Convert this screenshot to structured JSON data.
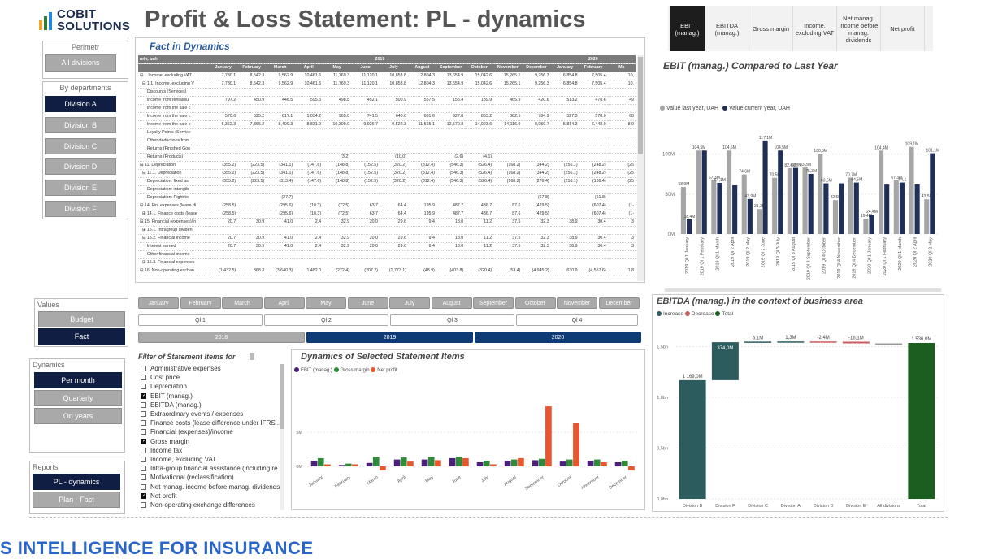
{
  "brand": {
    "logo_line1": "COBIT",
    "logo_line2": "SOLUTIONS",
    "logo_colors": [
      "#f5a623",
      "#2e7d32",
      "#1e88e5"
    ]
  },
  "title": "Profit & Loss Statement: PL - dynamics",
  "bottom_banner": "S INTELLIGENCE FOR INSURANCE",
  "perimetr": {
    "title": "Perimetr",
    "all_label": "All divisions",
    "by_departments": "By departments",
    "divisions": [
      "Division A",
      "Division B",
      "Division C",
      "Division D",
      "Division E",
      "Division F"
    ],
    "active": "Division A"
  },
  "values": {
    "title": "Values",
    "items": [
      "Budget",
      "Fact"
    ],
    "active": "Fact"
  },
  "dynamics": {
    "title": "Dynamics",
    "items": [
      "Per month",
      "Quarterly",
      "On years"
    ],
    "active": "Per month"
  },
  "reports": {
    "title": "Reports",
    "items": [
      "PL - dynamics",
      "Plan - Fact"
    ],
    "active": "PL - dynamics"
  },
  "fact_table": {
    "title": "Fact in Dynamics",
    "unit": "mln, uah",
    "years": [
      "2019",
      "2020"
    ],
    "months": [
      "January",
      "February",
      "March",
      "April",
      "May",
      "June",
      "July",
      "August",
      "September",
      "October",
      "November",
      "December",
      "January",
      "February",
      "Ma"
    ],
    "rows": [
      {
        "label": "⊟ I. Income, excluding VAT",
        "vals": [
          "7,780.1",
          "8,542.3",
          "9,562.9",
          "10,461.6",
          "11,769.3",
          "11,120.1",
          "10,853.8",
          "12,804.3",
          "13,654.9",
          "15,042.6",
          "15,265.1",
          "9,256.3",
          "6,854.8",
          "7,505.4",
          "10,"
        ]
      },
      {
        "label": "  ⊟ 1.1. Income, excluding V",
        "vals": [
          "7,780.1",
          "8,542.3",
          "9,562.9",
          "10,461.6",
          "11,769.3",
          "11,120.1",
          "10,853.8",
          "12,804.3",
          "13,654.9",
          "15,042.6",
          "15,265.1",
          "9,256.3",
          "6,854.8",
          "7,505.4",
          "10,"
        ]
      },
      {
        "label": "      Discounts (Services)",
        "vals": [
          "",
          "",
          "",
          "",
          "",
          "",
          "",
          "",
          "",
          "",
          "",
          "",
          "",
          "",
          ""
        ]
      },
      {
        "label": "      Income from rental/su",
        "vals": [
          "797.2",
          "450.9",
          "446.5",
          "595.5",
          "498.5",
          "452.1",
          "500.9",
          "557.5",
          "155.4",
          "189.9",
          "465.9",
          "420.6",
          "513.2",
          "478.6",
          "49"
        ]
      },
      {
        "label": "      Income from the sale c",
        "vals": [
          "",
          "",
          "",
          "",
          "",
          "",
          "",
          "",
          "",
          "",
          "",
          "",
          "",
          "",
          ""
        ]
      },
      {
        "label": "      Income from the sale c",
        "vals": [
          "570.6",
          "525.2",
          "617.1",
          "1,034.2",
          "965.0",
          "741.5",
          "640.6",
          "681.6",
          "927.8",
          "853.2",
          "682.5",
          "784.9",
          "527.3",
          "578.0",
          "68"
        ]
      },
      {
        "label": "      Income from the sale c",
        "vals": [
          "6,362.3",
          "7,366.2",
          "8,499.3",
          "8,831.9",
          "10,309.0",
          "9,926.7",
          "9,522.3",
          "11,565.1",
          "12,570.8",
          "14,023.6",
          "14,116.9",
          "8,050.7",
          "5,814.3",
          "6,448.9",
          "8,9"
        ]
      },
      {
        "label": "      Loyalty Points (Service",
        "vals": [
          "",
          "",
          "",
          "",
          "",
          "",
          "",
          "",
          "",
          "",
          "",
          "",
          "",
          "",
          ""
        ]
      },
      {
        "label": "      Other deductions from",
        "vals": [
          "",
          "",
          "",
          "",
          "",
          "",
          "",
          "",
          "",
          "",
          "",
          "",
          "",
          "",
          ""
        ]
      },
      {
        "label": "      Returns (Finished Goo",
        "vals": [
          "",
          "",
          "",
          "",
          "",
          "",
          "",
          "",
          "",
          "",
          "",
          "",
          "",
          "",
          ""
        ]
      },
      {
        "label": "      Returns (Products)",
        "vals": [
          "",
          "",
          "",
          "",
          "(3.2)",
          "",
          "(10.0)",
          "",
          "(2.6)",
          "(4.1)",
          "",
          "",
          "",
          "",
          ""
        ]
      },
      {
        "label": "⊟ 11. Depreciation",
        "vals": [
          "(355.2)",
          "(223.5)",
          "(341.1)",
          "(147.6)",
          "(148.8)",
          "(152.5)",
          "(320.2)",
          "(312.4)",
          "(546.3)",
          "(526.4)",
          "(168.2)",
          "(344.2)",
          "(256.1)",
          "(248.2)",
          "(25"
        ]
      },
      {
        "label": "  ⊟ 11.1. Depreciation",
        "vals": [
          "(355.2)",
          "(223.5)",
          "(341.1)",
          "(147.6)",
          "(148.8)",
          "(152.5)",
          "(320.2)",
          "(312.4)",
          "(546.3)",
          "(526.4)",
          "(168.2)",
          "(344.2)",
          "(256.1)",
          "(248.2)",
          "(25"
        ]
      },
      {
        "label": "      Depreciation: fixed as",
        "vals": [
          "(355.2)",
          "(223.5)",
          "(313.4)",
          "(147.6)",
          "(148.8)",
          "(152.5)",
          "(320.2)",
          "(312.4)",
          "(546.3)",
          "(526.4)",
          "(168.2)",
          "(276.4)",
          "(256.1)",
          "(186.4)",
          "(25"
        ]
      },
      {
        "label": "      Depreciation: intangib",
        "vals": [
          "",
          "",
          "",
          "",
          "",
          "",
          "",
          "",
          "",
          "",
          "",
          "",
          "",
          "",
          ""
        ]
      },
      {
        "label": "      Depreciation: Right to",
        "vals": [
          "",
          "",
          "(27.7)",
          "",
          "",
          "",
          "",
          "",
          "",
          "",
          "",
          "(67.8)",
          "",
          "(61.8)",
          ""
        ]
      },
      {
        "label": "⊟ 14. Fin. expenses (lease di",
        "vals": [
          "(258.5)",
          "",
          "(295.6)",
          "(10.3)",
          "(72.5)",
          "63.7",
          "64.4",
          "195.9",
          "487.7",
          "436.7",
          "87.6",
          "(429.5)",
          "",
          "(607.4)",
          "(1-"
        ]
      },
      {
        "label": "  ⊞ 14.1. Finance costs (lease",
        "vals": [
          "(258.5)",
          "",
          "(295.6)",
          "(10.3)",
          "(72.5)",
          "63.7",
          "64.4",
          "195.9",
          "487.7",
          "436.7",
          "87.6",
          "(429.5)",
          "",
          "(607.4)",
          "(1-"
        ]
      },
      {
        "label": "⊟ 15. Financial (expenses)/in",
        "vals": [
          "20.7",
          "30.9",
          "41.0",
          "2.4",
          "32.9",
          "20.0",
          "29.6",
          "9.4",
          "18.0",
          "11.2",
          "37.5",
          "32.3",
          "38.9",
          "30.4",
          "3"
        ]
      },
      {
        "label": "  ⊞ 15.1. Intragroup dividen",
        "vals": [
          "",
          "",
          "",
          "",
          "",
          "",
          "",
          "",
          "",
          "",
          "",
          "",
          "",
          "",
          ""
        ]
      },
      {
        "label": "  ⊟ 15.2. Financial income",
        "vals": [
          "20.7",
          "30.9",
          "41.0",
          "2.4",
          "32.9",
          "20.0",
          "29.6",
          "9.4",
          "18.0",
          "11.2",
          "37.5",
          "32.3",
          "38.9",
          "30.4",
          "3"
        ]
      },
      {
        "label": "      Interest earned",
        "vals": [
          "20.7",
          "30.9",
          "41.0",
          "2.4",
          "32.9",
          "20.0",
          "29.6",
          "9.4",
          "18.0",
          "11.2",
          "37.5",
          "32.3",
          "38.9",
          "30.4",
          "3"
        ]
      },
      {
        "label": "      Other financial income",
        "vals": [
          "",
          "",
          "",
          "",
          "",
          "",
          "",
          "",
          "",
          "",
          "",
          "",
          "",
          "",
          ""
        ]
      },
      {
        "label": "  ⊞ 15.3. Financial expenses",
        "vals": [
          "",
          "",
          "",
          "",
          "",
          "",
          "",
          "",
          "",
          "",
          "",
          "",
          "",
          "",
          ""
        ]
      },
      {
        "label": "⊟ 16. Non-operating exchan",
        "vals": [
          "(1,432.5)",
          "368.3",
          "(3,640.3)",
          "1,482.0",
          "(272.4)",
          "(207.2)",
          "(1,773.1)",
          "(48.9)",
          "(403.8)",
          "(320.4)",
          "(53.4)",
          "(4,945.2)",
          "630.9",
          "(4,557.6)",
          "1,8"
        ]
      }
    ]
  },
  "month_slicer": [
    "January",
    "February",
    "March",
    "April",
    "May",
    "June",
    "July",
    "August",
    "September",
    "October",
    "November",
    "December"
  ],
  "quarter_slicer": [
    "Ql 1",
    "Ql 2",
    "Ql 3",
    "Ql 4"
  ],
  "year_slicer": {
    "items": [
      "2018",
      "2019",
      "2020"
    ],
    "active": [
      "2019",
      "2020"
    ]
  },
  "filter": {
    "title": "Filter of Statement Items for",
    "items": [
      {
        "label": "Administrative expenses",
        "checked": false
      },
      {
        "label": "Cost price",
        "checked": false
      },
      {
        "label": "Depreciation",
        "checked": false
      },
      {
        "label": "EBIT (manag.)",
        "checked": true
      },
      {
        "label": "EBITDA (manag.)",
        "checked": false
      },
      {
        "label": "Extraordinary events / expenses",
        "checked": false
      },
      {
        "label": "Finance costs (lease difference under IFRS ...",
        "checked": false
      },
      {
        "label": "Financial (expenses)/income",
        "checked": false
      },
      {
        "label": "Gross margin",
        "checked": true
      },
      {
        "label": "Income tax",
        "checked": false
      },
      {
        "label": "Income, excluding VAT",
        "checked": false
      },
      {
        "label": "Intra-group financial assistance (including re...",
        "checked": false
      },
      {
        "label": "Motivational (reclassification)",
        "checked": false
      },
      {
        "label": "Net manag. income before manag. dividends",
        "checked": false
      },
      {
        "label": "Net profit",
        "checked": true
      },
      {
        "label": "Non-operating exchange differences",
        "checked": false
      }
    ]
  },
  "metric_tabs": {
    "items": [
      "EBIT (manag.)",
      "EBITDA (manag.)",
      "Gross margin",
      "Income, excluding VAT",
      "Net manag. income before manag. dividends",
      "Net profit"
    ],
    "active": "EBIT (manag.)"
  },
  "chart_data": [
    {
      "type": "bar",
      "title": "EBIT (manag.) Compared to Last Year",
      "categories": [
        "2019 Ql 1 January",
        "2019 Ql 1 February",
        "2019 Ql 1 March",
        "2019 Ql 2 April",
        "2019 Ql 2 May",
        "2019 Ql 2 June",
        "2019 Ql 3 July",
        "2019 Ql 3 August",
        "2019 Ql 3 September",
        "2019 Ql 4 October",
        "2019 Ql 4 November",
        "2019 Ql 4 December",
        "2020 Ql 1 January",
        "2020 Ql 1 February",
        "2020 Ql 1 March",
        "2020 Ql 2 April",
        "2020 Ql 2 May"
      ],
      "series": [
        {
          "name": "Value last year, UAH",
          "color": "#a6a6a6",
          "values": [
            58.9,
            104.5,
            67.3,
            104.5,
            74.6,
            31.3,
            70.5,
            82.4,
            83.3,
            100.5,
            42.5,
            70.7,
            19.4,
            104.4,
            67.3,
            109.1,
            43.5
          ]
        },
        {
          "name": "Value current year, UAH",
          "color": "#1f2f57",
          "values": [
            18.4,
            104.5,
            64.1,
            61.0,
            43.9,
            117.1,
            104.5,
            82.8,
            75.3,
            63.5,
            63.5,
            64.5,
            24.4,
            61.9,
            64.5,
            62.0,
            101.1
          ]
        }
      ],
      "labels_last": [
        "58,9M",
        "104,5M",
        "67,3M",
        "104,5M",
        "74,6M",
        "31,3M",
        "70,5M",
        "82,4M",
        "83,3M",
        "100,5M",
        "42,5M",
        "70,7M",
        "19,4M",
        "104,4M",
        "67,3M",
        "109,1M",
        "43,5M"
      ],
      "labels_current": [
        "18,4M",
        "",
        "64,1M",
        "",
        "43,9M",
        "117,1M",
        "104,5M",
        "82,8M",
        "75,3M",
        "63,5M",
        "",
        "64,5M",
        "24,4M",
        "",
        "64,1",
        "",
        "101,1M"
      ],
      "y_ticks": [
        "0M",
        "50M",
        "100M"
      ],
      "ylim": [
        0,
        120
      ],
      "legend": "top-left"
    },
    {
      "type": "bar",
      "subtype": "waterfall",
      "title": "EBITDA (manag.) in the context of business area",
      "legend": [
        {
          "name": "Increase",
          "color": "#2d5c5e"
        },
        {
          "name": "Decrease",
          "color": "#c95c5c"
        },
        {
          "name": "Total",
          "color": "#1b5e20"
        }
      ],
      "categories": [
        "Division B",
        "Division F",
        "Division C",
        "Division A",
        "Division D",
        "Division E",
        "All divisions",
        "Total"
      ],
      "values": [
        1169.0,
        374.0,
        6.1,
        1.3,
        -2.4,
        -16.1,
        1536.0,
        1536.0
      ],
      "value_labels": [
        "1 169,0M",
        "374,0M",
        "6,1M",
        "1,3M",
        "-2,4M",
        "-16,1M",
        "",
        "1 536,0M"
      ],
      "y_ticks": [
        "0,0bn",
        "0,5bn",
        "1,0bn",
        "1,5bn"
      ],
      "ylim": [
        0,
        1.6
      ]
    },
    {
      "type": "bar",
      "title": "Dynamics of Selected Statement Items",
      "categories": [
        "January",
        "February",
        "March",
        "April",
        "May",
        "June",
        "July",
        "August",
        "September",
        "October",
        "November",
        "December"
      ],
      "series": [
        {
          "name": "EBIT (manag.)",
          "color": "#4b1f7a",
          "values": [
            0.8,
            0.2,
            0.5,
            1.0,
            1.0,
            1.2,
            0.6,
            0.8,
            0.9,
            0.7,
            0.8,
            0.6
          ]
        },
        {
          "name": "Gross margin",
          "color": "#2e8b3a",
          "values": [
            1.2,
            0.4,
            1.4,
            1.3,
            1.4,
            1.4,
            0.8,
            1.0,
            1.1,
            1.0,
            1.0,
            0.8
          ]
        },
        {
          "name": "Net profit",
          "color": "#e8552e",
          "values": [
            0.3,
            0.3,
            -0.6,
            0.7,
            0.9,
            1.2,
            0.3,
            1.2,
            8.8,
            6.4,
            0.6,
            -0.6
          ]
        }
      ],
      "y_ticks": [
        "0M",
        "5M"
      ],
      "legend": "top-left"
    }
  ]
}
